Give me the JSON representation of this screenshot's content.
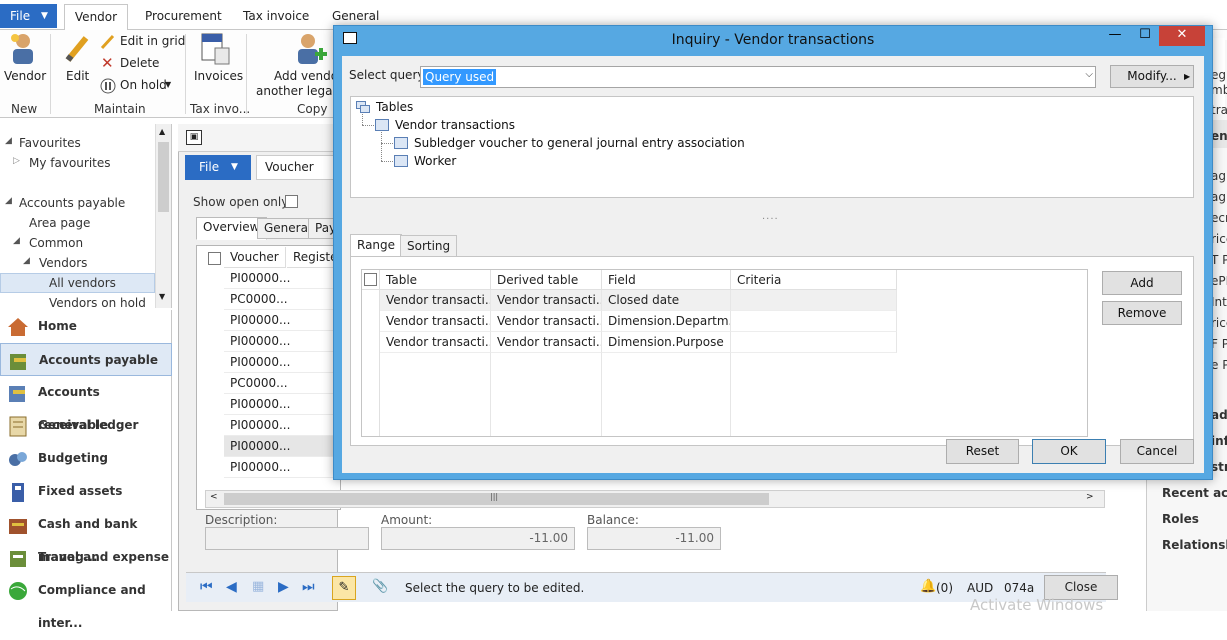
{
  "ribbon": {
    "file_label": "File",
    "tabs": [
      "Vendor",
      "Procurement",
      "Tax invoice",
      "General"
    ],
    "groups": {
      "new": "New",
      "maintain": "Maintain",
      "tax_invoice": "Tax invo...",
      "copy": "Copy"
    },
    "buttons": {
      "vendor": "Vendor",
      "edit": "Edit",
      "edit_in_grid": "Edit in grid",
      "delete": "Delete",
      "on_hold": "On hold",
      "invoices": "Invoices",
      "add_vendor_1": "Add vendo",
      "add_vendor_2": "another legal e"
    }
  },
  "nav_tree": {
    "favourites": "Favourites",
    "my_favourites": "My favourites",
    "accounts_payable": "Accounts payable",
    "area_page": "Area page",
    "common": "Common",
    "vendors": "Vendors",
    "all_vendors": "All vendors",
    "vendors_on_hold": "Vendors on hold"
  },
  "modules": [
    "Home",
    "Accounts payable",
    "Accounts receivable",
    "General ledger",
    "Budgeting",
    "Fixed assets",
    "Cash and bank manag...",
    "Travel and expense",
    "Compliance and inter..."
  ],
  "bg_form": {
    "file_label": "File",
    "voucher_tab": "Voucher",
    "show_open_only": "Show open only:",
    "tabs": [
      "Overview",
      "General",
      "Pay"
    ],
    "col_voucher": "Voucher",
    "col_register": "Register",
    "vouchers": [
      "PI00000...",
      "PC0000...",
      "PI00000...",
      "PI00000...",
      "PI00000...",
      "PC0000...",
      "PI00000...",
      "PI00000...",
      "PI00000...",
      "PI00000..."
    ],
    "description_label": "Description:",
    "amount_label": "Amount:",
    "amount_value": "-11.00",
    "balance_label": "Balance:",
    "balance_value": "-11.00",
    "status_text": "Select the query to be edited.",
    "alerts": "(0)",
    "currency": "AUD",
    "company": "074a",
    "close_label": "Close",
    "watermark": "Activate Windows"
  },
  "right_pane": {
    "cut_texts": [
      "egist",
      "mbe",
      "tratio",
      "enc",
      "agla",
      "agla",
      "ecru",
      "rices",
      "T P",
      "ePH",
      "Inte",
      "rices",
      "F Pty",
      "e Pty",
      "add",
      "info",
      "stra"
    ],
    "recent_activities": "Recent activ",
    "roles": "Roles",
    "relationship": "Relationship"
  },
  "dialog": {
    "title": "Inquiry - Vendor transactions",
    "controls": {
      "minimize": "—",
      "maximize": "☐",
      "close": "✕"
    },
    "select_query_label": "Select query:",
    "query_value": "Query used",
    "modify_label": "Modify...",
    "tree": {
      "root": "Tables",
      "level1": "Vendor transactions",
      "children": [
        "Subledger voucher to general journal entry association",
        "Worker"
      ]
    },
    "splitter": "....",
    "tabs": [
      "Range",
      "Sorting"
    ],
    "range_columns": [
      "Table",
      "Derived table",
      "Field",
      "Criteria"
    ],
    "range_rows": [
      {
        "table": "Vendor transacti...",
        "derived": "Vendor transacti...",
        "field": "Closed date",
        "criteria": ""
      },
      {
        "table": "Vendor transacti...",
        "derived": "Vendor transacti...",
        "field": "Dimension.Departm...",
        "criteria": ""
      },
      {
        "table": "Vendor transacti...",
        "derived": "Vendor transacti...",
        "field": "Dimension.Purpose",
        "criteria": ""
      }
    ],
    "add_label": "Add",
    "remove_label": "Remove",
    "reset_label": "Reset",
    "ok_label": "OK",
    "cancel_label": "Cancel"
  },
  "colors": {
    "dialog_frame": "#56a8e2",
    "file_blue": "#2b6cc4",
    "close_red": "#c74238",
    "selection": "#3399ff"
  }
}
